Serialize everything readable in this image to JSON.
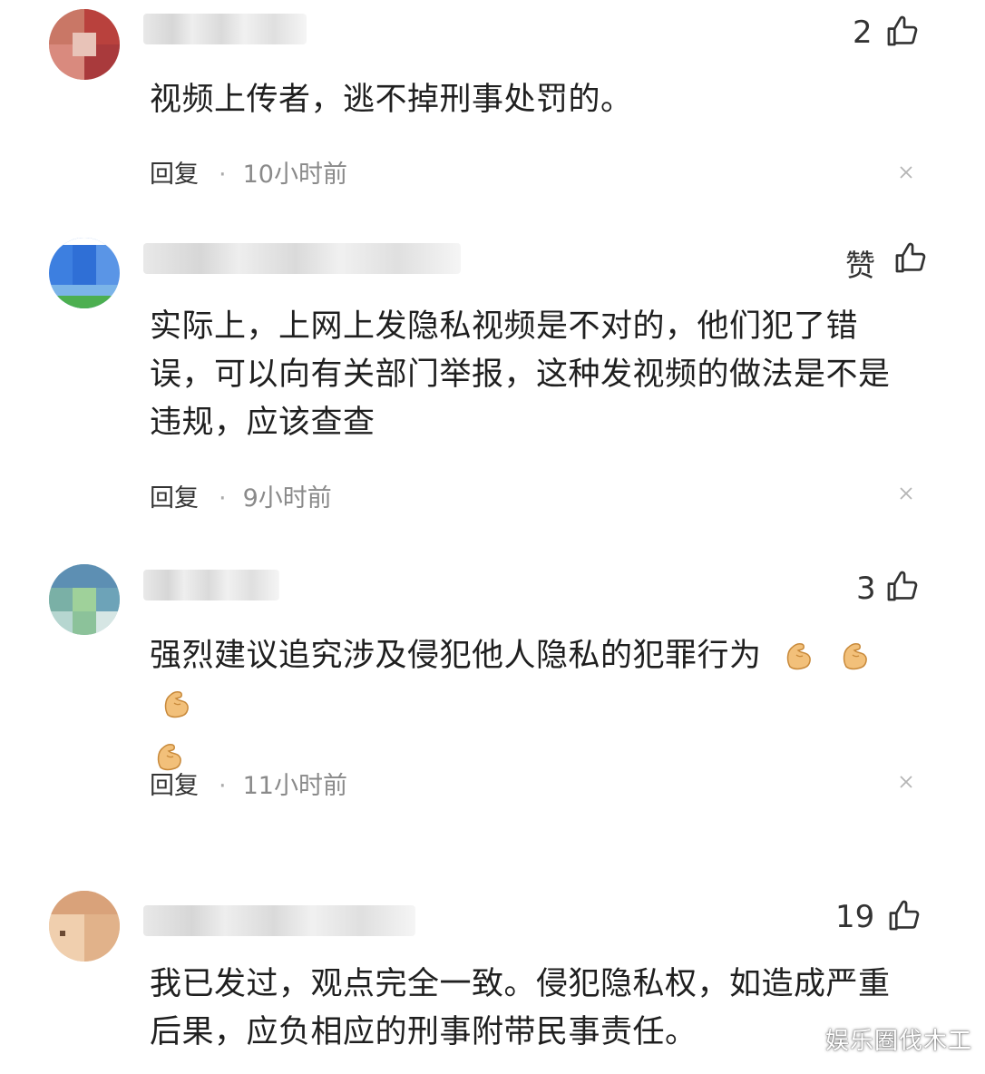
{
  "comments": [
    {
      "likes": "2",
      "text": "视频上传者，逃不掉刑事处罚的。",
      "reply_label": "回复",
      "separator": "·",
      "time": "10小时前"
    },
    {
      "likes": "赞",
      "text": "实际上，上网上发隐私视频是不对的，他们犯了错误，可以向有关部门举报，这种发视频的做法是不是违规，应该查查",
      "reply_label": "回复",
      "separator": "·",
      "time": "9小时前"
    },
    {
      "likes": "3",
      "text": "强烈建议追究涉及侵犯他人隐私的犯罪行为",
      "reply_label": "回复",
      "separator": "·",
      "time": "11小时前"
    },
    {
      "likes": "19",
      "text": "我已发过，观点完全一致。侵犯隐私权，如造成严重后果，应负相应的刑事附带民事责任。"
    }
  ],
  "icons": {
    "like": "thumbs-up-icon",
    "close": "close-icon",
    "emoji": "flexed-biceps-emoji"
  },
  "watermark": "娱乐圈伐木工",
  "colors": {
    "text": "#1f1f1f",
    "meta": "#8a8a8a",
    "like_icon": "#333333"
  }
}
